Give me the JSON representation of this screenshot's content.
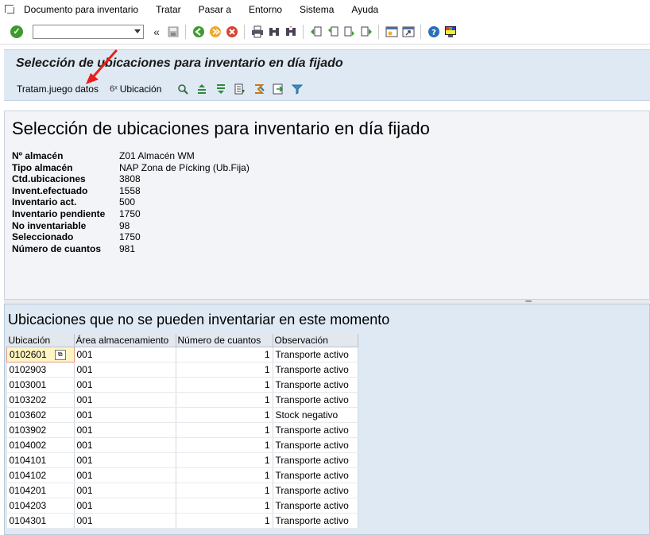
{
  "menu": {
    "items": [
      {
        "label": "Documento para inventario"
      },
      {
        "label": "Tratar"
      },
      {
        "label": "Pasar a"
      },
      {
        "label": "Entorno"
      },
      {
        "label": "Sistema"
      },
      {
        "label": "Ayuda"
      }
    ]
  },
  "toolbar": {
    "command_value": "",
    "back_glyph": "«"
  },
  "title": "Selección de ubicaciones para inventario en día fijado",
  "app_toolbar": {
    "dataset_label": "Tratam.juego datos",
    "location_label": "Ubicación",
    "location_glyph": "6ˣ"
  },
  "header": {
    "heading": "Selección de ubicaciones para inventario en día fijado",
    "fields": [
      {
        "label": "Nº almacén",
        "value": "Z01 Almacén WM"
      },
      {
        "label": "Tipo almacén",
        "value": "NAP Zona de Pícking (Ub.Fija)"
      },
      {
        "label": "Ctd.ubicaciones",
        "value": "3808"
      },
      {
        "label": "Invent.efectuado",
        "value": "1558"
      },
      {
        "label": "Inventario act.",
        "value": "500"
      },
      {
        "label": "Inventario pendiente",
        "value": "1750"
      },
      {
        "label": "No inventariable",
        "value": "98"
      },
      {
        "label": "Seleccionado",
        "value": "1750"
      },
      {
        "label": "Número de cuantos",
        "value": "981"
      }
    ]
  },
  "list": {
    "heading": "Ubicaciones que no se pueden inventariar en este momento",
    "columns": [
      "Ubicación",
      "Área almacenamiento",
      "Número de cuantos",
      "Observación"
    ],
    "rows": [
      [
        "0102601",
        "001",
        "1",
        "Transporte activo"
      ],
      [
        "0102903",
        "001",
        "1",
        "Transporte activo"
      ],
      [
        "0103001",
        "001",
        "1",
        "Transporte activo"
      ],
      [
        "0103202",
        "001",
        "1",
        "Transporte activo"
      ],
      [
        "0103602",
        "001",
        "1",
        "Stock negativo"
      ],
      [
        "0103902",
        "001",
        "1",
        "Transporte activo"
      ],
      [
        "0104002",
        "001",
        "1",
        "Transporte activo"
      ],
      [
        "0104101",
        "001",
        "1",
        "Transporte activo"
      ],
      [
        "0104102",
        "001",
        "1",
        "Transporte activo"
      ],
      [
        "0104201",
        "001",
        "1",
        "Transporte activo"
      ],
      [
        "0104203",
        "001",
        "1",
        "Transporte activo"
      ],
      [
        "0104301",
        "001",
        "1",
        "Transporte activo"
      ]
    ]
  },
  "colors": {
    "ok_green": "#3f9a2e",
    "panel_blue": "#dfe9f3",
    "selected_cell": "#fff5c2",
    "arrow_red": "#e8201b"
  }
}
